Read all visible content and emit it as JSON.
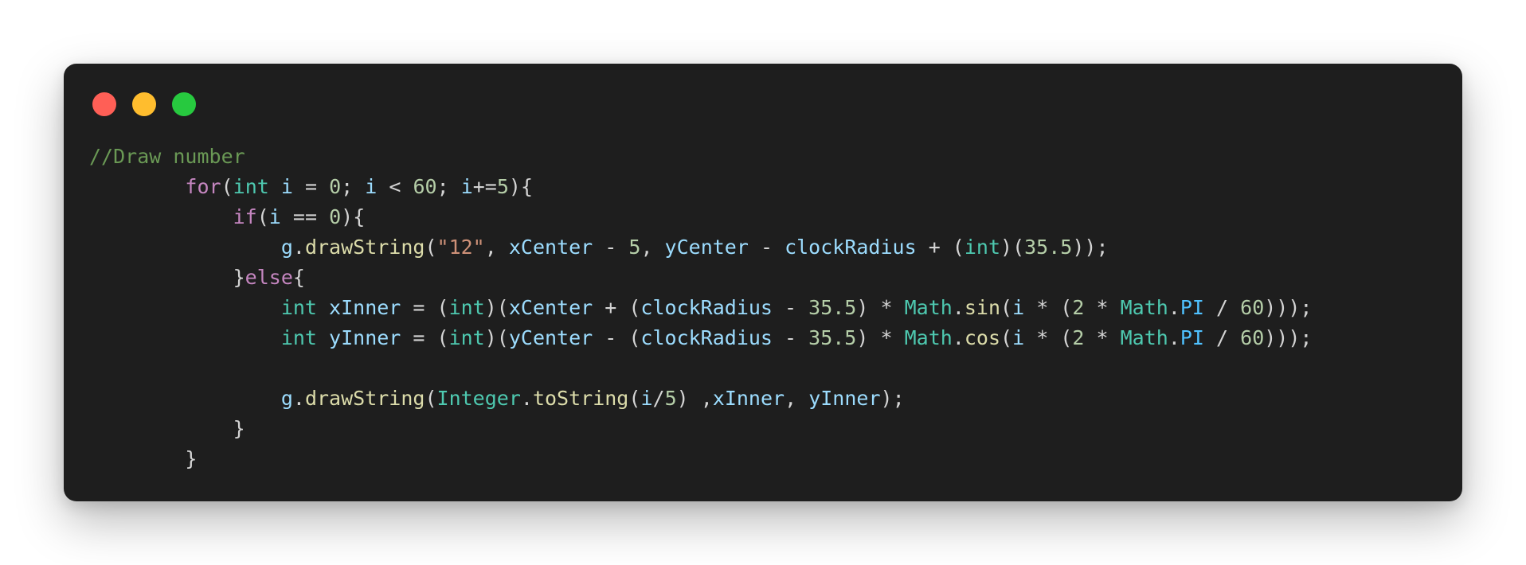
{
  "window": {
    "controls": [
      {
        "name": "close",
        "color": "#ff5f56"
      },
      {
        "name": "minimize",
        "color": "#ffbd2e"
      },
      {
        "name": "maximize",
        "color": "#27c93f"
      }
    ]
  },
  "colors": {
    "background": "#1e1e1e",
    "comment": "#6a9955",
    "keyword": "#c586c0",
    "type": "#4ec9b0",
    "variable": "#9cdcfe",
    "number": "#b5cea8",
    "string": "#ce9178",
    "function": "#dcdcaa",
    "constant": "#4fc1ff",
    "plain": "#d4d4d4"
  },
  "code": {
    "language": "java",
    "lines": [
      [
        [
          "comment",
          "//Draw number"
        ]
      ],
      [
        [
          "plain",
          "        "
        ],
        [
          "keyword",
          "for"
        ],
        [
          "plain",
          "("
        ],
        [
          "type",
          "int"
        ],
        [
          "plain",
          " "
        ],
        [
          "var",
          "i"
        ],
        [
          "plain",
          " = "
        ],
        [
          "number",
          "0"
        ],
        [
          "plain",
          "; "
        ],
        [
          "var",
          "i"
        ],
        [
          "plain",
          " < "
        ],
        [
          "number",
          "60"
        ],
        [
          "plain",
          "; "
        ],
        [
          "var",
          "i"
        ],
        [
          "plain",
          "+="
        ],
        [
          "number",
          "5"
        ],
        [
          "plain",
          "){"
        ]
      ],
      [
        [
          "plain",
          "            "
        ],
        [
          "keyword",
          "if"
        ],
        [
          "plain",
          "("
        ],
        [
          "var",
          "i"
        ],
        [
          "plain",
          " == "
        ],
        [
          "number",
          "0"
        ],
        [
          "plain",
          "){"
        ]
      ],
      [
        [
          "plain",
          "                "
        ],
        [
          "var",
          "g"
        ],
        [
          "plain",
          "."
        ],
        [
          "func",
          "drawString"
        ],
        [
          "plain",
          "("
        ],
        [
          "string",
          "\"12\""
        ],
        [
          "plain",
          ", "
        ],
        [
          "var",
          "xCenter"
        ],
        [
          "plain",
          " - "
        ],
        [
          "number",
          "5"
        ],
        [
          "plain",
          ", "
        ],
        [
          "var",
          "yCenter"
        ],
        [
          "plain",
          " - "
        ],
        [
          "var",
          "clockRadius"
        ],
        [
          "plain",
          " + ("
        ],
        [
          "type",
          "int"
        ],
        [
          "plain",
          ")("
        ],
        [
          "number",
          "35.5"
        ],
        [
          "plain",
          "));"
        ]
      ],
      [
        [
          "plain",
          "            }"
        ],
        [
          "keyword",
          "else"
        ],
        [
          "plain",
          "{"
        ]
      ],
      [
        [
          "plain",
          "                "
        ],
        [
          "type",
          "int"
        ],
        [
          "plain",
          " "
        ],
        [
          "var",
          "xInner"
        ],
        [
          "plain",
          " = ("
        ],
        [
          "type",
          "int"
        ],
        [
          "plain",
          ")("
        ],
        [
          "var",
          "xCenter"
        ],
        [
          "plain",
          " + ("
        ],
        [
          "var",
          "clockRadius"
        ],
        [
          "plain",
          " - "
        ],
        [
          "number",
          "35.5"
        ],
        [
          "plain",
          ") * "
        ],
        [
          "type",
          "Math"
        ],
        [
          "plain",
          "."
        ],
        [
          "func",
          "sin"
        ],
        [
          "plain",
          "("
        ],
        [
          "var",
          "i"
        ],
        [
          "plain",
          " * ("
        ],
        [
          "number",
          "2"
        ],
        [
          "plain",
          " * "
        ],
        [
          "type",
          "Math"
        ],
        [
          "plain",
          "."
        ],
        [
          "const",
          "PI"
        ],
        [
          "plain",
          " / "
        ],
        [
          "number",
          "60"
        ],
        [
          "plain",
          ")));"
        ]
      ],
      [
        [
          "plain",
          "                "
        ],
        [
          "type",
          "int"
        ],
        [
          "plain",
          " "
        ],
        [
          "var",
          "yInner"
        ],
        [
          "plain",
          " = ("
        ],
        [
          "type",
          "int"
        ],
        [
          "plain",
          ")("
        ],
        [
          "var",
          "yCenter"
        ],
        [
          "plain",
          " - ("
        ],
        [
          "var",
          "clockRadius"
        ],
        [
          "plain",
          " - "
        ],
        [
          "number",
          "35.5"
        ],
        [
          "plain",
          ") * "
        ],
        [
          "type",
          "Math"
        ],
        [
          "plain",
          "."
        ],
        [
          "func",
          "cos"
        ],
        [
          "plain",
          "("
        ],
        [
          "var",
          "i"
        ],
        [
          "plain",
          " * ("
        ],
        [
          "number",
          "2"
        ],
        [
          "plain",
          " * "
        ],
        [
          "type",
          "Math"
        ],
        [
          "plain",
          "."
        ],
        [
          "const",
          "PI"
        ],
        [
          "plain",
          " / "
        ],
        [
          "number",
          "60"
        ],
        [
          "plain",
          ")));"
        ]
      ],
      [
        [
          "plain",
          ""
        ]
      ],
      [
        [
          "plain",
          "                "
        ],
        [
          "var",
          "g"
        ],
        [
          "plain",
          "."
        ],
        [
          "func",
          "drawString"
        ],
        [
          "plain",
          "("
        ],
        [
          "type",
          "Integer"
        ],
        [
          "plain",
          "."
        ],
        [
          "func",
          "toString"
        ],
        [
          "plain",
          "("
        ],
        [
          "var",
          "i"
        ],
        [
          "plain",
          "/"
        ],
        [
          "number",
          "5"
        ],
        [
          "plain",
          ") ,"
        ],
        [
          "var",
          "xInner"
        ],
        [
          "plain",
          ", "
        ],
        [
          "var",
          "yInner"
        ],
        [
          "plain",
          ");"
        ]
      ],
      [
        [
          "plain",
          "            }"
        ]
      ],
      [
        [
          "plain",
          "        }"
        ]
      ]
    ]
  }
}
